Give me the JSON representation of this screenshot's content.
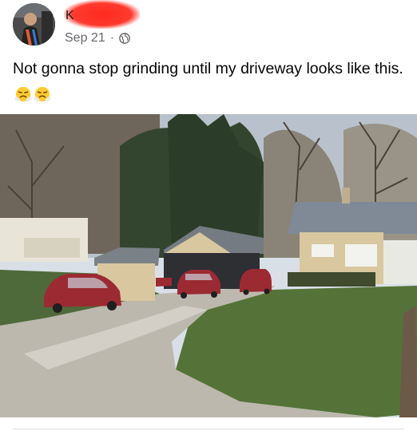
{
  "post": {
    "author_initial": "K",
    "date": "Sep 21",
    "separator": "·",
    "audience_icon": "globe-icon",
    "text": "Not gonna stop grinding until my driveway looks like this.",
    "emojis": [
      "face-with-steam-icon",
      "face-with-steam-icon"
    ]
  },
  "colors": {
    "redaction": "#ff2a1f",
    "meta_text": "#65676b",
    "body_text": "#050505"
  }
}
